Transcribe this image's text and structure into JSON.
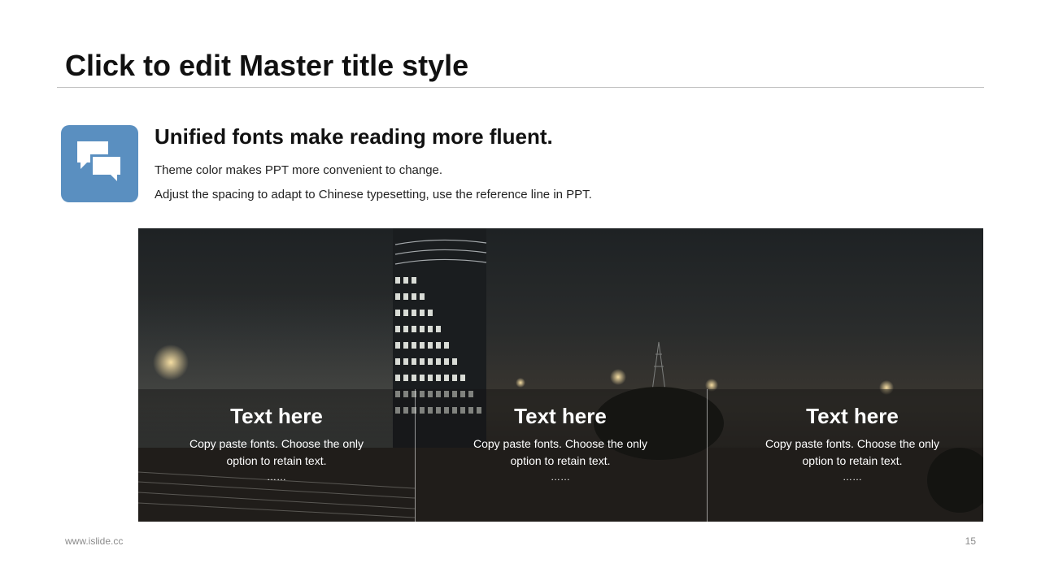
{
  "slide": {
    "title": "Click to edit Master title style",
    "heading": "Unified fonts make reading more fluent.",
    "line1": "Theme color makes PPT more convenient to change.",
    "line2": "Adjust the spacing to adapt to Chinese typesetting, use the reference line in PPT.",
    "icon": "chat-bubbles-icon",
    "accent_color": "#5a8fc0"
  },
  "columns": [
    {
      "title": "Text here",
      "text": "Copy paste fonts. Choose the only option to retain text.",
      "dots": "……"
    },
    {
      "title": "Text here",
      "text": "Copy paste fonts. Choose the only option to retain text.",
      "dots": "……"
    },
    {
      "title": "Text here",
      "text": "Copy paste fonts. Choose the only option to retain text.",
      "dots": "……"
    }
  ],
  "footer": {
    "website": "www.islide.cc",
    "page_number": "15"
  }
}
